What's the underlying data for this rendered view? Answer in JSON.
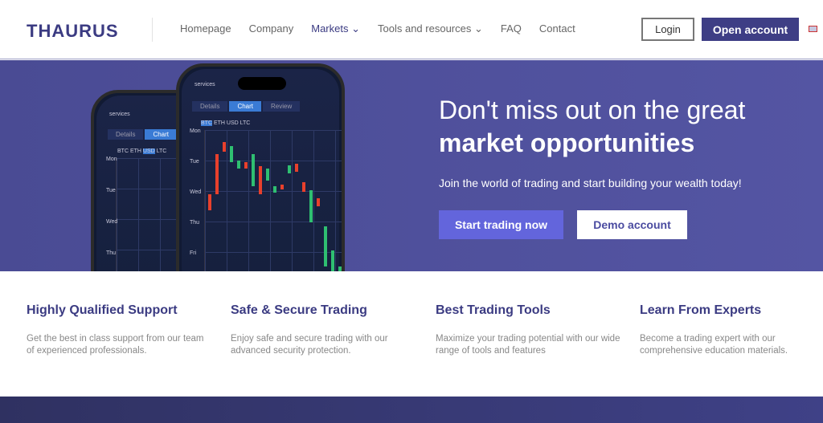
{
  "header": {
    "logo": "THAURUS",
    "nav": [
      "Homepage",
      "Company",
      "Markets",
      "Tools and resources",
      "FAQ",
      "Contact"
    ],
    "active_nav": "Markets",
    "login": "Login",
    "open_account": "Open account",
    "language": "en-gb-flag-icon"
  },
  "hero": {
    "title_line1": "Don't miss out on the great",
    "title_line2": "market opportunities",
    "subtitle": "Join the world of trading and start building your wealth today!",
    "start_button": "Start trading now",
    "demo_button": "Demo account",
    "phone_back": {
      "label": "services",
      "tabs": [
        "Details",
        "Chart"
      ],
      "currencies": [
        "BTC",
        "ETH",
        "USD",
        "LTC"
      ],
      "selected": "USD",
      "days": [
        "Mon",
        "Tue",
        "Wed",
        "Thu"
      ]
    },
    "phone_front": {
      "label": "services",
      "tabs": [
        "Details",
        "Chart",
        "Review"
      ],
      "selected_tab": "Chart",
      "currencies": [
        "BTC",
        "ETH",
        "USD",
        "LTC"
      ],
      "selected": "BTC",
      "days": [
        "Mon",
        "Tue",
        "Wed",
        "Thu",
        "Fri"
      ]
    }
  },
  "features": [
    {
      "title": "Highly Qualified Support",
      "text": "Get the best in class support from our team of experienced professionals."
    },
    {
      "title": "Safe & Secure Trading",
      "text": "Enjoy safe and secure trading with our advanced security protection."
    },
    {
      "title": "Best Trading Tools",
      "text": "Maximize your trading potential with our wide range of tools and features"
    },
    {
      "title": "Learn From Experts",
      "text": "Become a trading expert with our comprehensive education materials."
    }
  ],
  "colors": {
    "brand": "#3e3e85",
    "hero_bg": "#4e4f9c",
    "accent": "#6365dc",
    "candle_up": "#2fbf71",
    "candle_down": "#e8402c"
  }
}
